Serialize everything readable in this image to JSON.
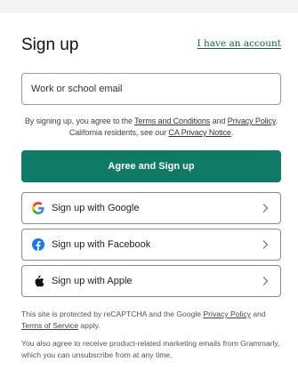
{
  "header": {
    "title": "Sign up",
    "login_link": "I have an account"
  },
  "form": {
    "email_placeholder": "Work or school email",
    "legal": {
      "prefix": "By signing up, you agree to the",
      "terms": "Terms and Conditions",
      "and": "and",
      "privacy": "Privacy Policy",
      "line2_prefix": ". California residents, see our",
      "ca_notice": "CA Privacy Notice",
      "end": "."
    },
    "primary_button": "Agree and Sign up"
  },
  "social": [
    {
      "label": "Sign up with Google",
      "icon": "google-icon"
    },
    {
      "label": "Sign up with Facebook",
      "icon": "facebook-icon"
    },
    {
      "label": "Sign up with Apple",
      "icon": "apple-icon"
    }
  ],
  "footer": {
    "recaptcha_prefix": "This site is protected by reCAPTCHA and the Google",
    "privacy_link": "Privacy Policy",
    "and": "and",
    "terms_link": "Terms of Service",
    "apply": "apply.",
    "marketing": "You also agree to receive product-related marketing emails from Grammarly, which you can unsubscribe from at any time."
  },
  "colors": {
    "accent": "#0f7a66",
    "link": "#0f5e4c",
    "facebook": "#1877f2"
  }
}
